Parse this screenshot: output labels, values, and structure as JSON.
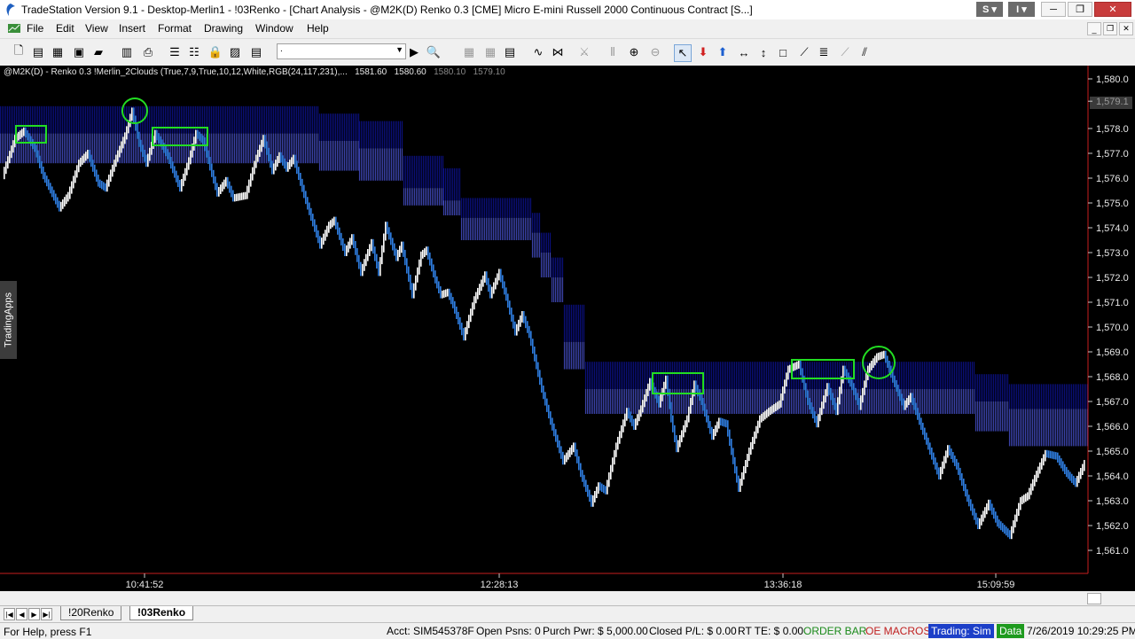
{
  "window": {
    "title": "TradeStation Version 9.1 - Desktop-Merlin1 - !03Renko - [Chart Analysis - @M2K(D) Renko 0.3 [CME] Micro E-mini Russell 2000 Continuous Contract [S...]",
    "sbtn": "S",
    "ibtn": "I",
    "min": "─",
    "max": "❐",
    "close": "✕"
  },
  "menu": {
    "items": [
      "File",
      "Edit",
      "View",
      "Insert",
      "Format",
      "Drawing",
      "Window",
      "Help"
    ]
  },
  "toolbar": {
    "combo_value": "."
  },
  "chart": {
    "info": {
      "symbol": "@M2K(D) - Renko 0.3",
      "study": "!Merlin_2Clouds (True,7,9,True,10,12,White,RGB(24,117,231),...",
      "v1": "1581.60",
      "v2": "1580.60",
      "v3": "1580.10",
      "v4": "1579.10"
    },
    "side_tab": "TradingApps",
    "price_labels": [
      "1,580.0",
      "1,579.1",
      "1,578.0",
      "1,577.0",
      "1,576.0",
      "1,575.0",
      "1,574.0",
      "1,573.0",
      "1,572.0",
      "1,571.0",
      "1,570.0",
      "1,569.0",
      "1,568.0",
      "1,567.0",
      "1,566.0",
      "1,565.0",
      "1,564.0",
      "1,563.0",
      "1,562.0",
      "1,561.0"
    ],
    "time_labels": [
      "10:41:52",
      "12:28:13",
      "13:36:18",
      "15:09:59"
    ],
    "colors": {
      "up_brick": "#ffffff",
      "down_brick": "#2e7de0",
      "cloud_dark": "#0a0f78",
      "cloud_light": "#3a42a8",
      "highlight": "#22dd22",
      "axis": "#c81e1e"
    }
  },
  "tabs": {
    "sheets": [
      "!20Renko",
      "!03Renko"
    ]
  },
  "status": {
    "help": "For Help, press F1",
    "acct": "Acct: SIM545378F",
    "open_psns": "Open Psns: 0",
    "purch": "Purch Pwr: $ 5,000.00",
    "closed_pl": "Closed P/L: $ 0.00",
    "rtte": "RT TE: $ 0.00",
    "order_bar": "ORDER BAR",
    "oe_macros": "OE MACROS",
    "trading": "Trading: Sim",
    "data": "Data",
    "datetime": "7/26/2019 10:29:25 PM"
  }
}
